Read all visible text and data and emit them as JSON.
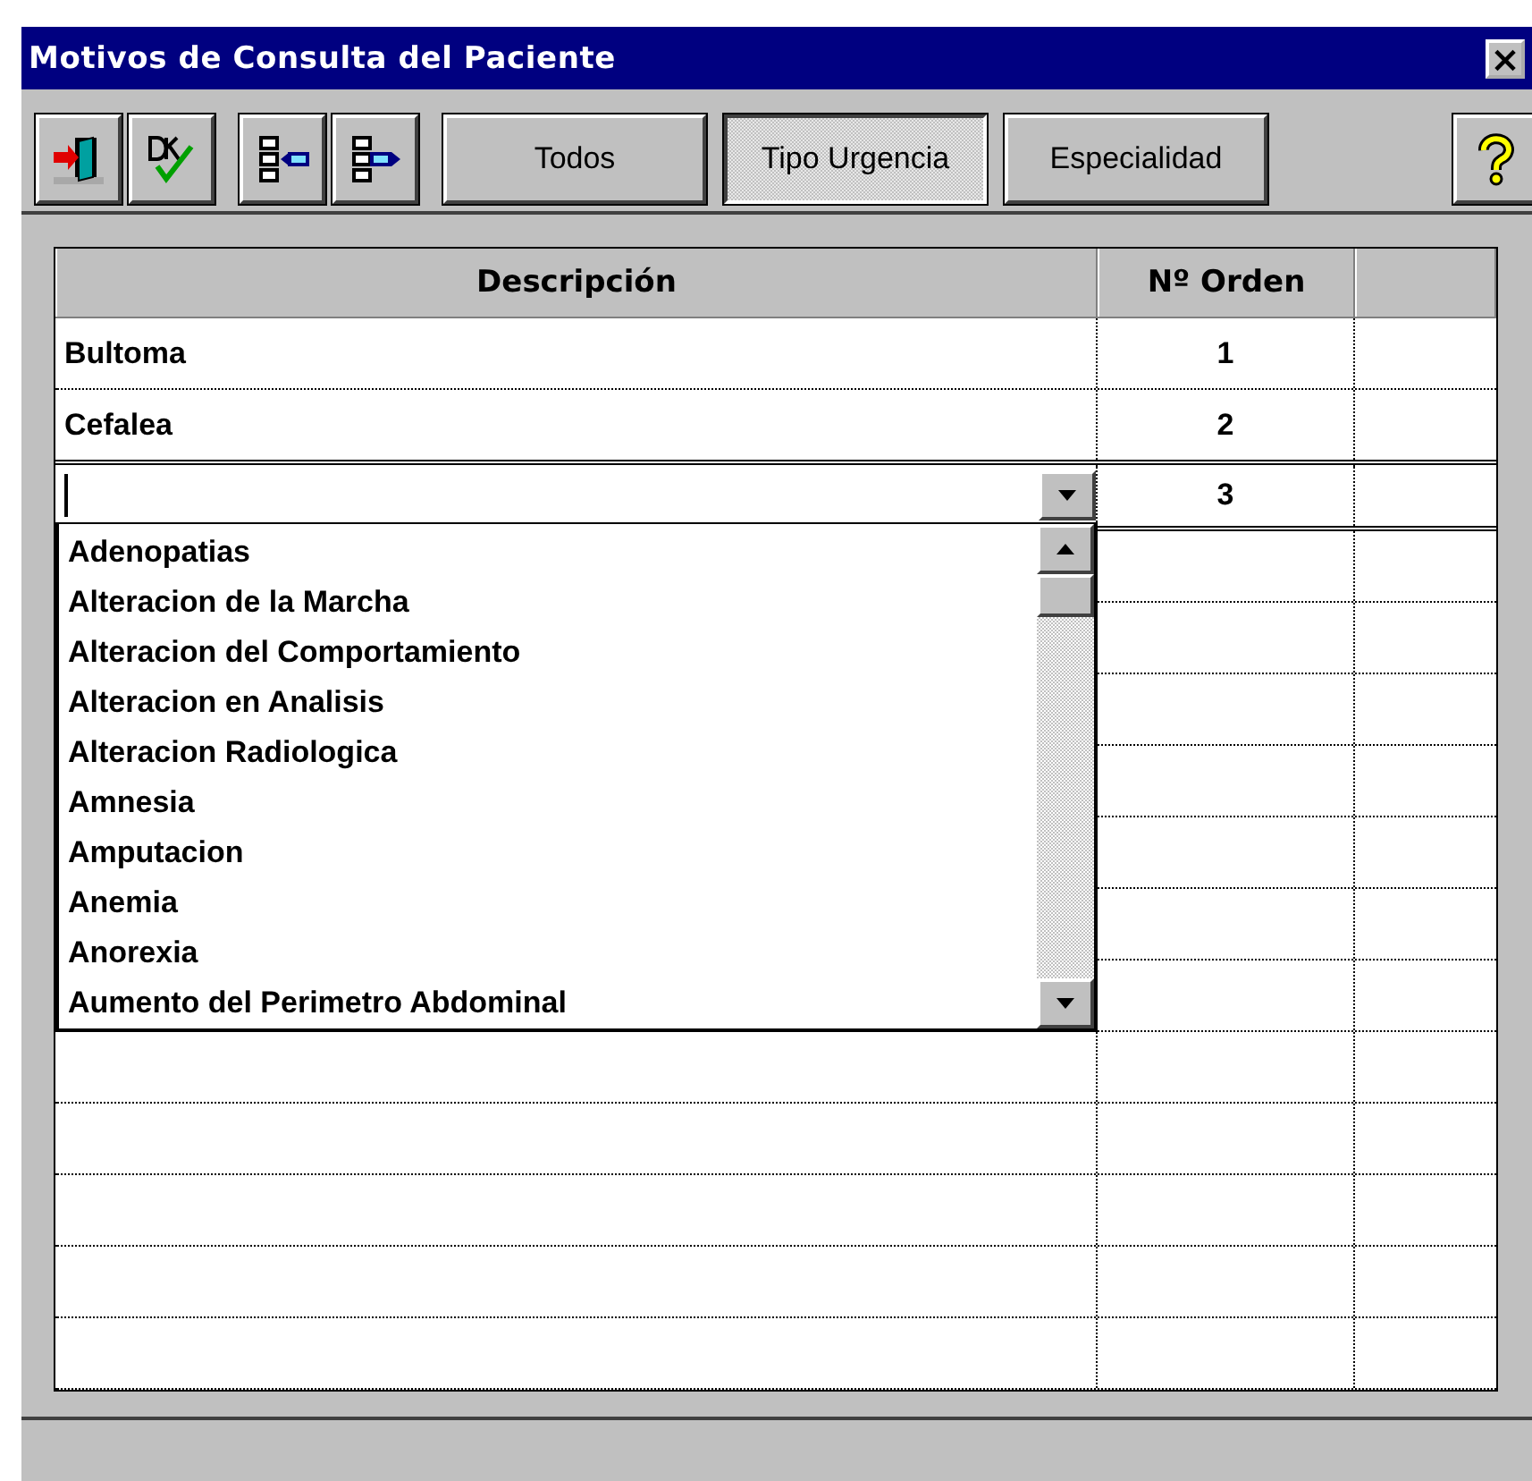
{
  "window": {
    "title": "Motivos de Consulta del Paciente",
    "close": "×"
  },
  "toolbar": {
    "buttons": [
      {
        "kind": "exit"
      },
      {
        "kind": "ok"
      },
      {
        "kind": "collapse"
      },
      {
        "kind": "expand"
      }
    ],
    "filters": [
      {
        "label": "Todos",
        "selected": false
      },
      {
        "label": "Tipo Urgencia",
        "selected": true
      },
      {
        "label": "Especialidad",
        "selected": false
      }
    ],
    "help": {
      "kind": "help"
    }
  },
  "table": {
    "columns": [
      "Descripción",
      "Nº Orden"
    ],
    "rows": [
      {
        "kind": "text",
        "descripcion": "Bultoma",
        "orden": "1"
      },
      {
        "kind": "text",
        "descripcion": "Cefalea",
        "orden": "2"
      },
      {
        "kind": "combo",
        "descripcion": "",
        "orden": "3"
      }
    ],
    "dropdown": {
      "items": [
        "Adenopatias",
        "Alteracion de la Marcha",
        "Alteracion del Comportamiento",
        "Alteracion en Analisis",
        "Alteracion Radiologica",
        "Amnesia",
        "Amputacion",
        "Anemia",
        "Anorexia",
        "Aumento del Perimetro Abdominal"
      ]
    }
  }
}
